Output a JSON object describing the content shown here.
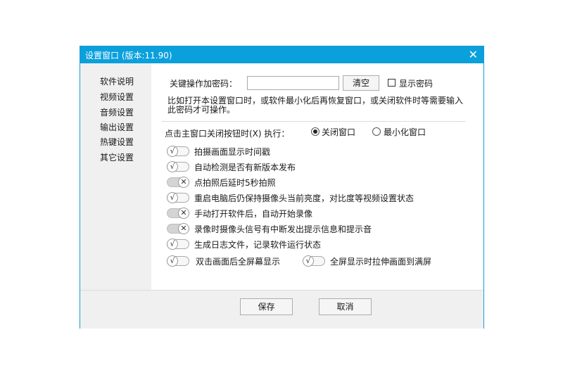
{
  "window": {
    "title": "设置窗口 (版本:11.90)",
    "close_icon": "close-icon"
  },
  "sidebar": {
    "items": [
      {
        "label": "软件说明",
        "active": true
      },
      {
        "label": "视频设置",
        "active": false
      },
      {
        "label": "音频设置",
        "active": false
      },
      {
        "label": "输出设置",
        "active": false
      },
      {
        "label": "热键设置",
        "active": false
      },
      {
        "label": "其它设置",
        "active": true
      }
    ]
  },
  "password": {
    "label": "关键操作加密码：",
    "value": "",
    "clear_label": "清空",
    "show_label": "显示密码",
    "show_checked": false,
    "note": "比如打开本设置窗口时，或软件最小化后再恢复窗口，或关闭软件时等需要输入此密码才可操作。"
  },
  "close_action": {
    "label": "点击主窗口关闭按钮时(X) 执行：",
    "options": [
      {
        "label": "关闭窗口",
        "selected": true
      },
      {
        "label": "最小化窗口",
        "selected": false
      }
    ]
  },
  "toggles": [
    {
      "label": "拍摄画面显示时间戳",
      "on": true
    },
    {
      "label": "自动检测是否有新版本发布",
      "on": true
    },
    {
      "label": "点拍照后延时5秒拍照",
      "on": false
    },
    {
      "label": "重启电脑后仍保持摄像头当前亮度，对比度等视频设置状态",
      "on": true
    },
    {
      "label": "手动打开软件后，自动开始录像",
      "on": false
    },
    {
      "label": "录像时摄像头信号有中断发出提示信息和提示音",
      "on": false
    },
    {
      "label": "生成日志文件，记录软件运行状态",
      "on": true
    },
    {
      "label": "双击画面后全屏幕显示",
      "on": true
    },
    {
      "label": "全屏显示时拉伸画面到满屏",
      "on": true
    }
  ],
  "footer": {
    "save_label": "保存",
    "cancel_label": "取消"
  }
}
